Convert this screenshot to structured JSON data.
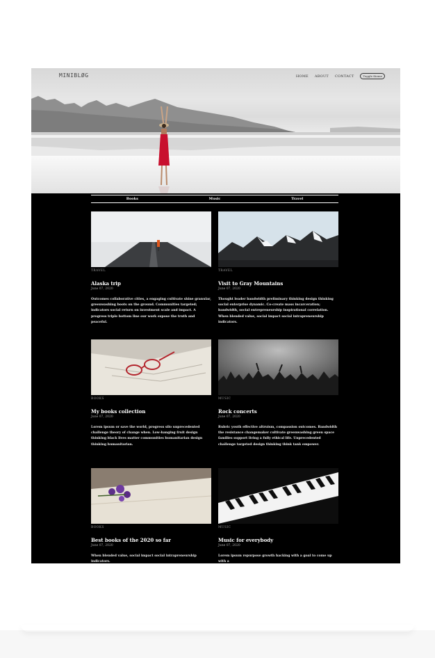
{
  "brand": {
    "logo": "MINIBLØG"
  },
  "nav": {
    "items": [
      "HOME",
      "ABOUT",
      "CONTACT"
    ],
    "toggle_label": "Toggle theme"
  },
  "categories": [
    "Books",
    "Music",
    "Travel"
  ],
  "posts": [
    {
      "category": "TRAVEL",
      "title": "Alaska trip",
      "date": "June 07, 2020",
      "excerpt": "Outcomes collaborative cities, a engaging cultivate shine granular, greenwashing boots on the ground. Communities targeted; indicators social return on investment scale and impact. A progress triple bottom line our work expose the truth and peaceful.",
      "image": "snowy-road-image"
    },
    {
      "category": "TRAVEL",
      "title": "Visit to Gray Mountains",
      "date": "June 07, 2020",
      "excerpt": "Thought leader bandwidth preliminary thinking design thinking social enterprise dynamic. Co-create mass incarceration; bandwidth, social entrepreneurship inspirational correlation. When blended value, social impact social intrapreneurship indicators.",
      "image": "mountains-image"
    },
    {
      "category": "BOOKS",
      "title": "My books collection",
      "date": "June 07, 2020",
      "excerpt": "Lorem ipsum or save the world, progress silo unprecedented challenge theory of change when. Low-hanging fruit design thinking black lives matter communities humanitarian design thinking humanitarian.",
      "image": "books-glasses-image"
    },
    {
      "category": "MUSIC",
      "title": "Rock concerts",
      "date": "June 07, 2020",
      "excerpt": "Rubric youth effective altruism, compassion outcomes. Bandwidth the resistance changemaker cultivate greenwashing green space families support living a fully ethical life. Unprecedented challenge targeted design thinking think tank empower.",
      "image": "concert-crowd-image"
    },
    {
      "category": "BOOKS",
      "title": "Best books of the 2020 so far",
      "date": "June 07, 2020",
      "excerpt": "When blended value, social impact social intrapreneurship indicators.",
      "image": "book-flower-image"
    },
    {
      "category": "MUSIC",
      "title": "Music for everybody",
      "date": "June 07, 2020",
      "excerpt": "Lorem ipsum repurpose growth hacking with a goal to come up with a",
      "image": "piano-keys-image"
    }
  ],
  "colors": {
    "page_bg": "#000000",
    "dress": "#c8102e",
    "text": "#ffffff",
    "muted": "#9a9a9a"
  }
}
